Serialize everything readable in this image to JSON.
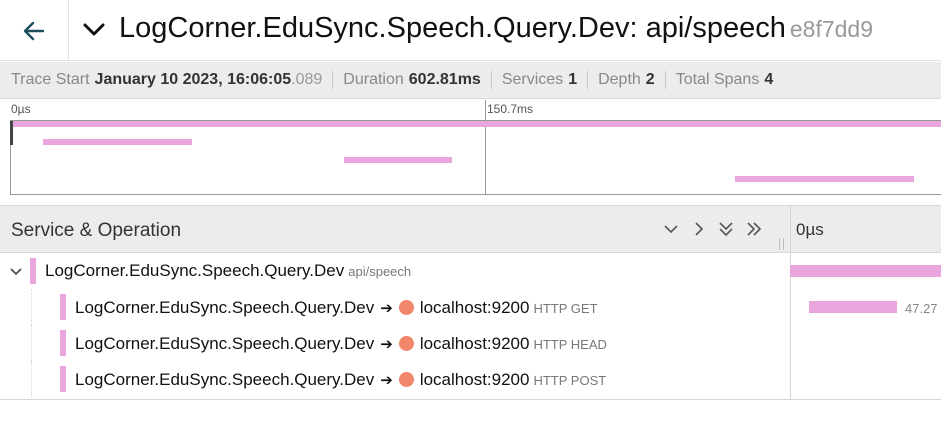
{
  "header": {
    "back_icon": "arrow-left-icon",
    "chevron_icon": "chevron-down-icon",
    "title": "LogCorner.EduSync.Speech.Query.Dev: api/speech",
    "trace_id": "e8f7dd9"
  },
  "summary": {
    "trace_start_label": "Trace Start",
    "trace_start_value": "January 10 2023, 16:06:05",
    "trace_start_ms": ".089",
    "duration_label": "Duration",
    "duration_value": "602.81ms",
    "services_label": "Services",
    "services_value": "1",
    "depth_label": "Depth",
    "depth_value": "2",
    "total_spans_label": "Total Spans",
    "total_spans_value": "4"
  },
  "minimap": {
    "tick_start": "0µs",
    "tick_mid": "150.7ms"
  },
  "timeline": {
    "title": "Service & Operation",
    "controls": [
      "chevron-down-icon",
      "chevron-right-icon",
      "double-chevron-down-icon",
      "double-chevron-right-icon"
    ],
    "time_label": "0µs"
  },
  "spans": [
    {
      "service": "LogCorner.EduSync.Speech.Query.Dev",
      "operation": "api/speech",
      "endpoint": "",
      "method": "",
      "duration": ""
    },
    {
      "service": "LogCorner.EduSync.Speech.Query.Dev",
      "operation": "",
      "endpoint": "localhost:9200",
      "method": "HTTP GET",
      "duration": "47.27"
    },
    {
      "service": "LogCorner.EduSync.Speech.Query.Dev",
      "operation": "",
      "endpoint": "localhost:9200",
      "method": "HTTP HEAD",
      "duration": ""
    },
    {
      "service": "LogCorner.EduSync.Speech.Query.Dev",
      "operation": "",
      "endpoint": "localhost:9200",
      "method": "HTTP POST",
      "duration": ""
    }
  ],
  "colors": {
    "service": "#e8a6dd",
    "endpoint_dot": "#f0866a"
  }
}
